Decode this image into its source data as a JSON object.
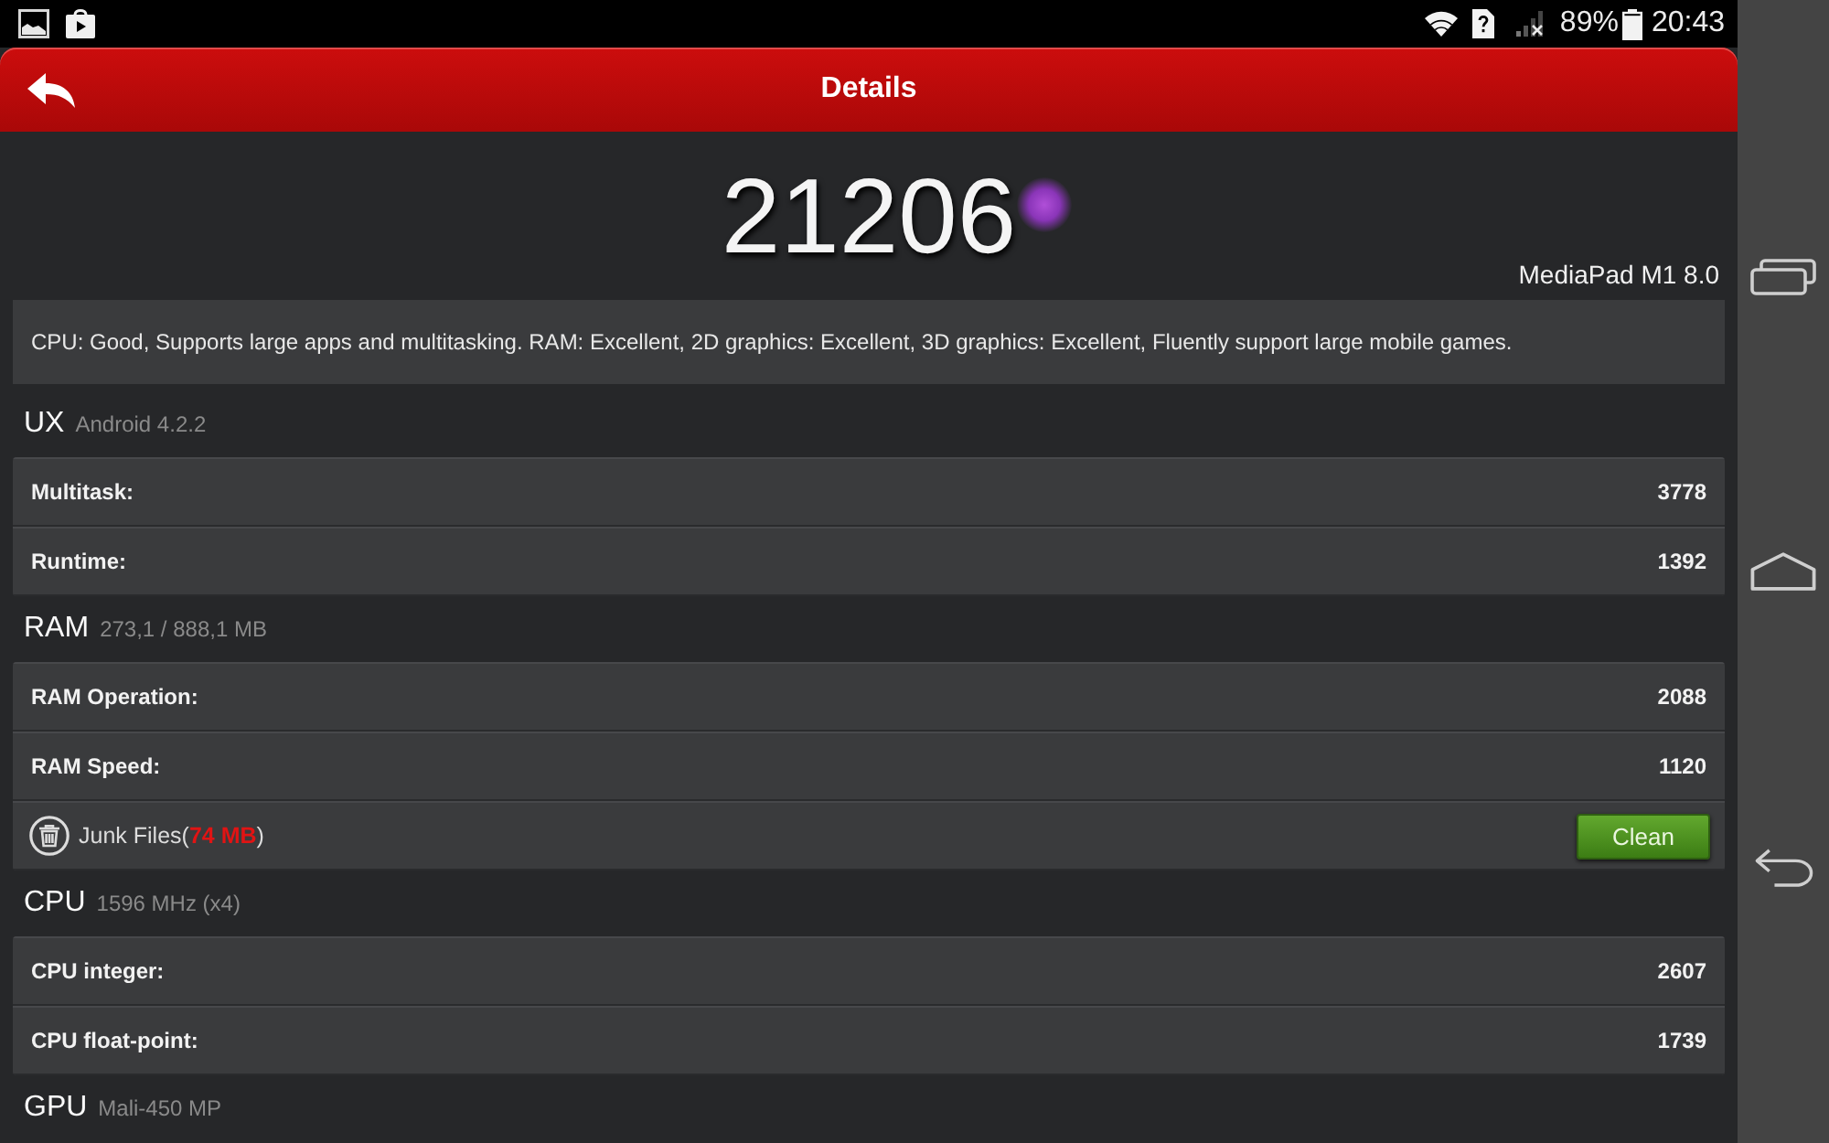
{
  "status_bar": {
    "battery": "89%",
    "time": "20:43"
  },
  "header": {
    "title": "Details"
  },
  "score": "21206",
  "device": "MediaPad M1 8.0",
  "summary": "CPU: Good, Supports large apps and multitasking. RAM: Excellent, 2D graphics: Excellent, 3D graphics: Excellent, Fluently support large mobile games.",
  "sections": [
    {
      "title": "UX",
      "subtitle": "Android 4.2.2",
      "rows": [
        {
          "kind": "metric",
          "label": "Multitask:",
          "value": "3778"
        },
        {
          "kind": "metric",
          "label": "Runtime:",
          "value": "1392"
        }
      ]
    },
    {
      "title": "RAM",
      "subtitle": "273,1 / 888,1 MB",
      "rows": [
        {
          "kind": "metric",
          "label": "RAM Operation:",
          "value": "2088"
        },
        {
          "kind": "metric",
          "label": "RAM Speed:",
          "value": "1120"
        },
        {
          "kind": "cleanup",
          "label": "Junk Files(",
          "amount": "74 MB",
          "label_end": ")",
          "button": "Clean"
        }
      ]
    },
    {
      "title": "CPU",
      "subtitle": "1596 MHz (x4)",
      "rows": [
        {
          "kind": "metric",
          "label": "CPU integer:",
          "value": "2607"
        },
        {
          "kind": "metric",
          "label": "CPU float-point:",
          "value": "1739"
        }
      ]
    },
    {
      "title": "GPU",
      "subtitle": "Mali-450 MP"
    }
  ]
}
